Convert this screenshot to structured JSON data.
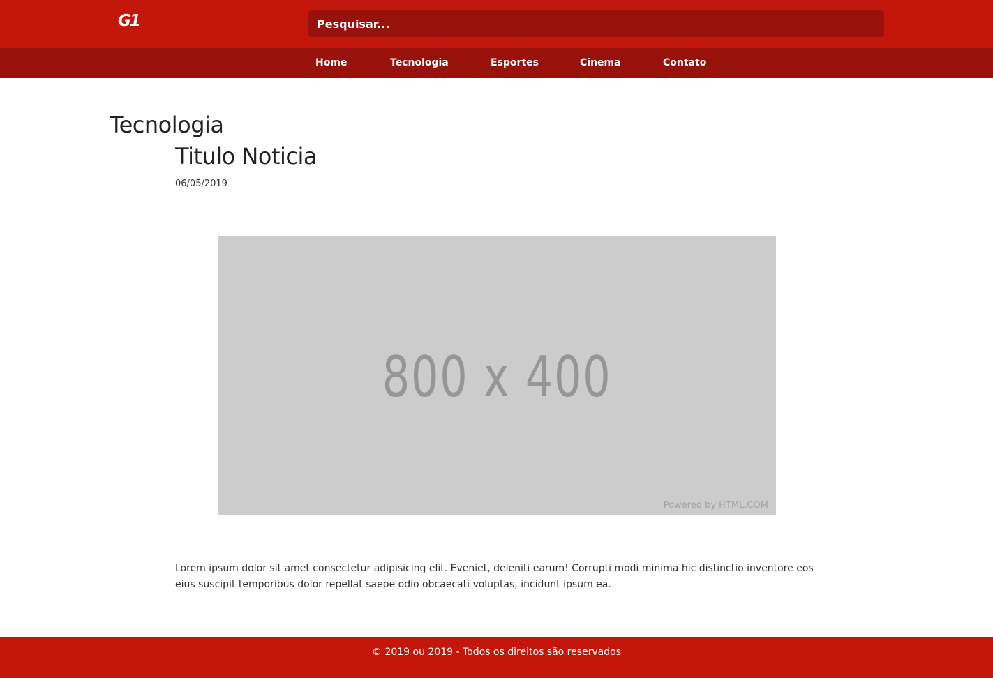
{
  "header": {
    "logo": "G1",
    "search_placeholder": "Pesquisar...",
    "colors": {
      "topbar": "#c4170c",
      "navbar": "#99110b",
      "search_bg": "#99110b"
    }
  },
  "nav": {
    "items": [
      {
        "label": "Home"
      },
      {
        "label": "Tecnologia"
      },
      {
        "label": "Esportes"
      },
      {
        "label": "Cinema"
      },
      {
        "label": "Contato"
      }
    ]
  },
  "article": {
    "section": "Tecnologia",
    "title": "Titulo Noticia",
    "date": "06/05/2019",
    "image": {
      "label": "800 x 400",
      "credit": "Powered by HTML.COM",
      "bg_color": "#cccccc"
    },
    "body": "Lorem ipsum dolor sit amet consectetur adipisicing elit. Eveniet, deleniti earum! Corrupti modi minima hic distinctio inventore eos eius suscipit temporibus dolor repellat saepe odio obcaecati voluptas, incidunt ipsum ea."
  },
  "footer": {
    "text": "© 2019 ou 2019 - Todos os direitos são reservados"
  }
}
